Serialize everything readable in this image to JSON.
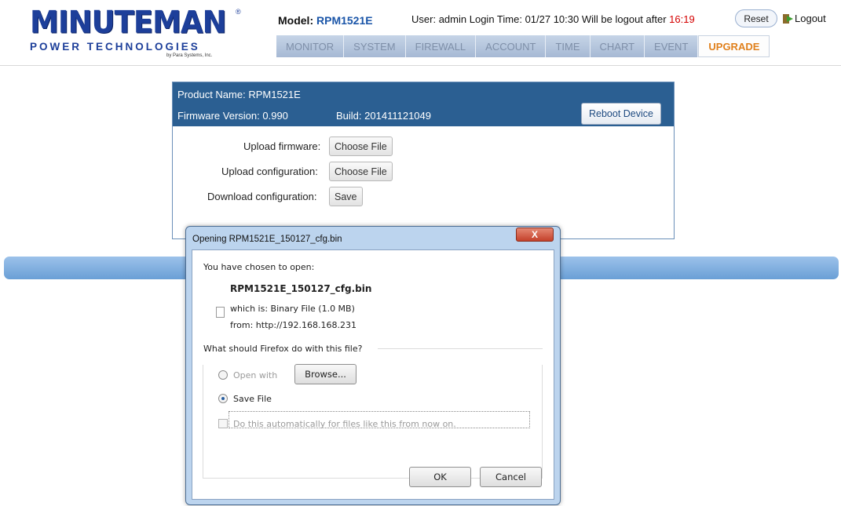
{
  "header": {
    "logo_text": "MINUTEMAN",
    "logo_registered": "®",
    "logo_subtitle": "POWER TECHNOLOGIES",
    "logo_small": "by Para Systems, Inc.",
    "model_label": "Model:",
    "model_value": "RPM1521E",
    "user_label": "User:",
    "user_value": "admin",
    "login_time_label": "Login Time:",
    "login_time_value": "01/27 10:30",
    "logout_label": "Will be logout after",
    "logout_countdown": "16:19",
    "reset_label": "Reset",
    "logout_link": "Logout",
    "tabs": [
      {
        "label": "MONITOR"
      },
      {
        "label": "SYSTEM"
      },
      {
        "label": "FIREWALL"
      },
      {
        "label": "ACCOUNT"
      },
      {
        "label": "TIME"
      },
      {
        "label": "CHART"
      },
      {
        "label": "EVENT"
      },
      {
        "label": "UPGRADE"
      }
    ],
    "active_tab": "UPGRADE",
    "colors": {
      "brand": "#1d3f9a",
      "active_tab": "#e0801c",
      "countdown": "#d40000",
      "panel_header": "#2b5f92"
    }
  },
  "panel": {
    "product_name_label": "Product Name:",
    "product_name": "RPM1521E",
    "firmware_label": "Firmware Version:",
    "firmware_version": "0.990",
    "build_label": "Build:",
    "build_value": "201411121049",
    "reboot_label": "Reboot Device",
    "upload_firmware_label": "Upload firmware:",
    "upload_firmware_button": "Choose File",
    "upload_config_label": "Upload configuration:",
    "upload_config_button": "Choose File",
    "download_config_label": "Download configuration:",
    "download_config_button": "Save"
  },
  "dialog": {
    "title": "Opening RPM1521E_150127_cfg.bin",
    "close_label": "X",
    "chosen_text": "You have chosen to open:",
    "file_name": "RPM1521E_150127_cfg.bin",
    "which_is": "which is: Binary File (1.0 MB)",
    "from": "from: http://192.168.168.231",
    "question": "What should Firefox do with this file?",
    "open_with_label": "Open with",
    "browse_label": "Browse...",
    "save_file_label": "Save File",
    "auto_label": "Do this automatically for files like this from now on.",
    "ok_label": "OK",
    "cancel_label": "Cancel"
  }
}
